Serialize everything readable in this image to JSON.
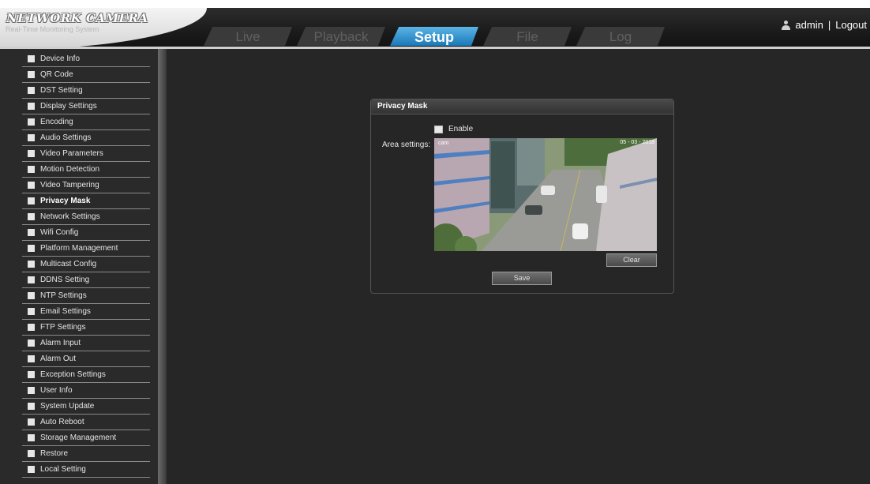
{
  "header": {
    "brand": "NETWORK CAMERA",
    "tagline": "Real-Time Monitoring System",
    "user_name": "admin",
    "separator": "|",
    "logout_label": "Logout"
  },
  "tabs": [
    {
      "label": "Live"
    },
    {
      "label": "Playback"
    },
    {
      "label": "Setup"
    },
    {
      "label": "File"
    },
    {
      "label": "Log"
    }
  ],
  "active_tab": "Setup",
  "sidebar": {
    "items": [
      {
        "label": "Device Info"
      },
      {
        "label": "QR Code"
      },
      {
        "label": "DST Setting"
      },
      {
        "label": "Display Settings"
      },
      {
        "label": "Encoding"
      },
      {
        "label": "Audio Settings"
      },
      {
        "label": "Video Parameters"
      },
      {
        "label": "Motion Detection"
      },
      {
        "label": "Video Tampering"
      },
      {
        "label": "Privacy Mask"
      },
      {
        "label": "Network Settings"
      },
      {
        "label": "Wifi Config"
      },
      {
        "label": "Platform Management"
      },
      {
        "label": "Multicast Config"
      },
      {
        "label": "DDNS Setting"
      },
      {
        "label": "NTP Settings"
      },
      {
        "label": "Email Settings"
      },
      {
        "label": "FTP Settings"
      },
      {
        "label": "Alarm Input"
      },
      {
        "label": "Alarm Out"
      },
      {
        "label": "Exception Settings"
      },
      {
        "label": "User Info"
      },
      {
        "label": "System Update"
      },
      {
        "label": "Auto Reboot"
      },
      {
        "label": "Storage Management"
      },
      {
        "label": "Restore"
      },
      {
        "label": "Local Setting"
      }
    ],
    "active_index": 9
  },
  "panel": {
    "title": "Privacy Mask",
    "enable_label": "Enable",
    "enable_checked": false,
    "area_label": "Area settings:",
    "osd_left": "cam",
    "osd_right": "05 - 03 - 2018",
    "clear_label": "Clear",
    "save_label": "Save"
  },
  "colors": {
    "active_tab": "#1b78b7",
    "background": "#262626",
    "header": "#1a1a1a"
  }
}
